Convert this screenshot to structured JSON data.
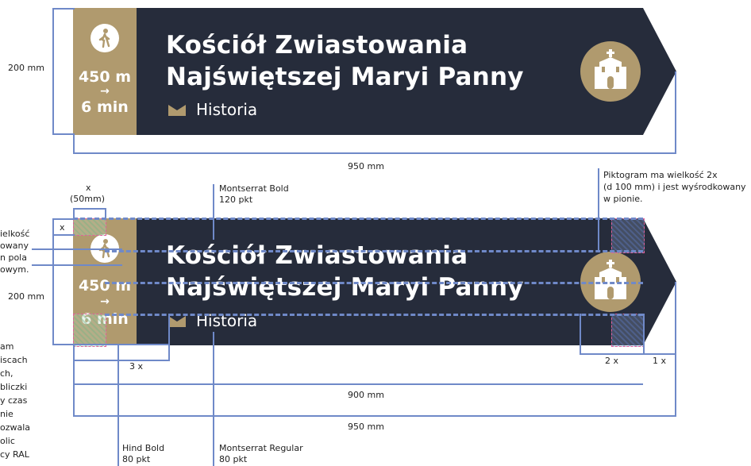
{
  "sign_top": {
    "distance": "450 m",
    "arrow": "→",
    "time": "6 min",
    "title_line1": "Kościół Zwiastowania",
    "title_line2": "Najświętszej Maryi Panny",
    "category": "Historia"
  },
  "sign_bottom": {
    "distance": "450 m",
    "arrow": "→",
    "time": "6 min",
    "title_line1": "Kościół Zwiastowania",
    "title_line2": "Najświętszej Maryi Panny",
    "category": "Historia"
  },
  "dimensions": {
    "height_top": "200 mm",
    "width_top": "950 mm",
    "height_bottom": "200 mm",
    "x_label": "x",
    "x_mm": "(50mm)",
    "x_small": "x",
    "three_x": "3 x",
    "two_x": "2 x",
    "one_x": "1 x",
    "width_900": "900 mm",
    "width_950": "950 mm"
  },
  "annotations": {
    "montserrat_bold": [
      "Montserrat Bold",
      "120 pkt"
    ],
    "pictogram_note": [
      "Piktogram ma wielkość 2x",
      "(d 100 mm) i jest wyśrodkowany",
      "w pionie."
    ],
    "hind_bold": [
      "Hind Bold",
      "80 pkt"
    ],
    "montserrat_regular": [
      "Montserrat Regular",
      "80 pkt"
    ],
    "left_note_top": [
      "ielkość",
      "owany",
      "n pola",
      "owym."
    ],
    "left_note_bottom": [
      "am",
      "iscach",
      "ch,",
      "bliczki",
      "y czas",
      "nie",
      "ozwala",
      "olic",
      "cy RAL"
    ]
  },
  "colors": {
    "navy": "#262c3b",
    "gold": "#b09a6e",
    "guide": "#6f89c8",
    "hatch_border": "#e0609a"
  },
  "icons": {
    "walk": "pedestrian-icon",
    "church": "church-icon",
    "category": "book-icon"
  }
}
